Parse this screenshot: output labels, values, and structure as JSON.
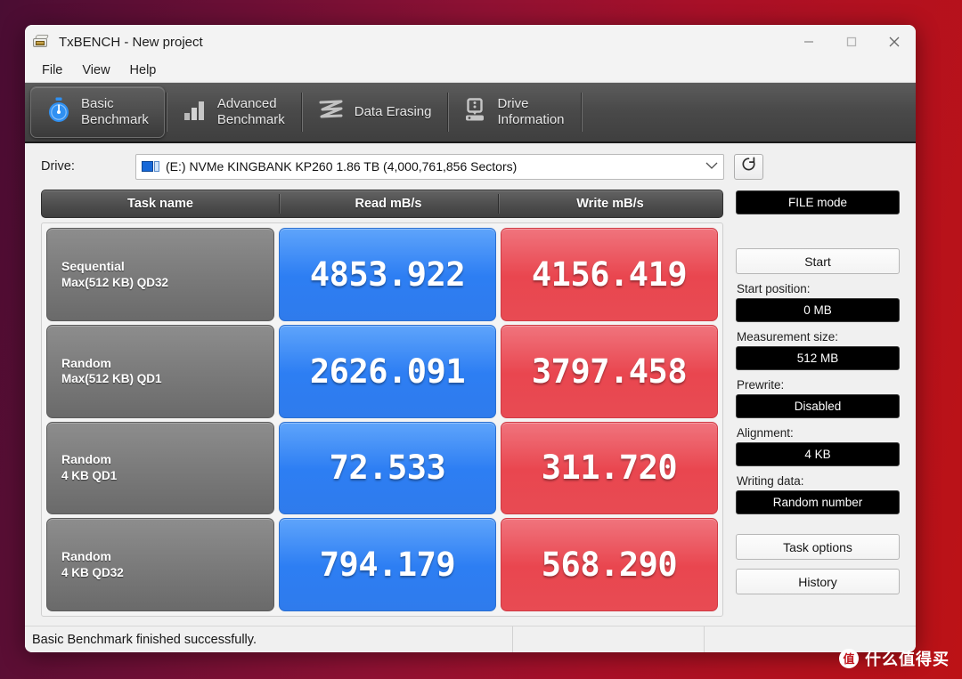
{
  "window": {
    "title": "TxBENCH - New project",
    "app_icon": "drive-device-icon",
    "controls": {
      "minimize": "minimize-icon",
      "maximize": "maximize-icon",
      "close": "close-icon"
    }
  },
  "menubar": {
    "items": [
      {
        "label": "File"
      },
      {
        "label": "View"
      },
      {
        "label": "Help"
      }
    ]
  },
  "tabs": [
    {
      "label_line1": "Basic",
      "label_line2": "Benchmark",
      "icon": "stopwatch-icon",
      "active": true
    },
    {
      "label_line1": "Advanced",
      "label_line2": "Benchmark",
      "icon": "bar-chart-icon",
      "active": false
    },
    {
      "label_line1": "Data Erasing",
      "label_line2": "",
      "icon": "shred-wave-icon",
      "active": false
    },
    {
      "label_line1": "Drive",
      "label_line2": "Information",
      "icon": "hard-drive-icon",
      "active": false
    }
  ],
  "drive": {
    "label": "Drive:",
    "selected": "(E:) NVMe KINGBANK KP260  1.86 TB (4,000,761,856 Sectors)",
    "icon": "disk-drive-icon",
    "chevron": "chevron-down-icon",
    "refresh": "refresh-icon"
  },
  "results": {
    "headers": {
      "task": "Task name",
      "read": "Read mB/s",
      "write": "Write mB/s"
    },
    "rows": [
      {
        "name": "Sequential",
        "detail": "Max(512 KB) QD32",
        "read": "4853.922",
        "write": "4156.419"
      },
      {
        "name": "Random",
        "detail": "Max(512 KB) QD1",
        "read": "2626.091",
        "write": "3797.458"
      },
      {
        "name": "Random",
        "detail": "4 KB QD1",
        "read": "72.533",
        "write": "311.720"
      },
      {
        "name": "Random",
        "detail": "4 KB QD32",
        "read": "794.179",
        "write": "568.290"
      }
    ]
  },
  "sidebar": {
    "file_mode": "FILE mode",
    "start_button": "Start",
    "start_position_caption": "Start position:",
    "start_position_value": "0 MB",
    "measurement_size_caption": "Measurement size:",
    "measurement_size_value": "512 MB",
    "prewrite_caption": "Prewrite:",
    "prewrite_value": "Disabled",
    "alignment_caption": "Alignment:",
    "alignment_value": "4 KB",
    "writing_data_caption": "Writing data:",
    "writing_data_value": "Random number",
    "task_options_button": "Task options",
    "history_button": "History"
  },
  "statusbar": {
    "message": "Basic Benchmark finished successfully."
  },
  "watermark": {
    "badge": "值",
    "text": "什么值得买"
  },
  "colors": {
    "read_bar": "#2d7ef3",
    "write_bar": "#e9464f",
    "task_bar": "#7b7b7b",
    "accent_tab": "#3190f0",
    "desktop_left": "#4a0d33",
    "desktop_right": "#bc1216"
  }
}
